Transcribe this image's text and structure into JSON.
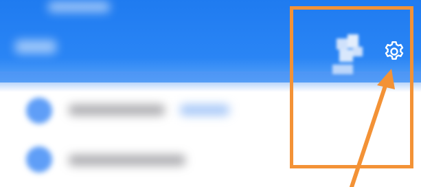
{
  "screen": {
    "header_color": "#1f7bf0",
    "accent_annotation_color": "#f39236"
  },
  "header": {
    "settings_icon": "gear-icon"
  },
  "list": {
    "items": [
      {
        "icon": "blurred-avatar"
      },
      {
        "icon": "blurred-avatar"
      }
    ]
  },
  "annotation": {
    "box": "highlight-box",
    "arrow": "pointer-arrow"
  }
}
